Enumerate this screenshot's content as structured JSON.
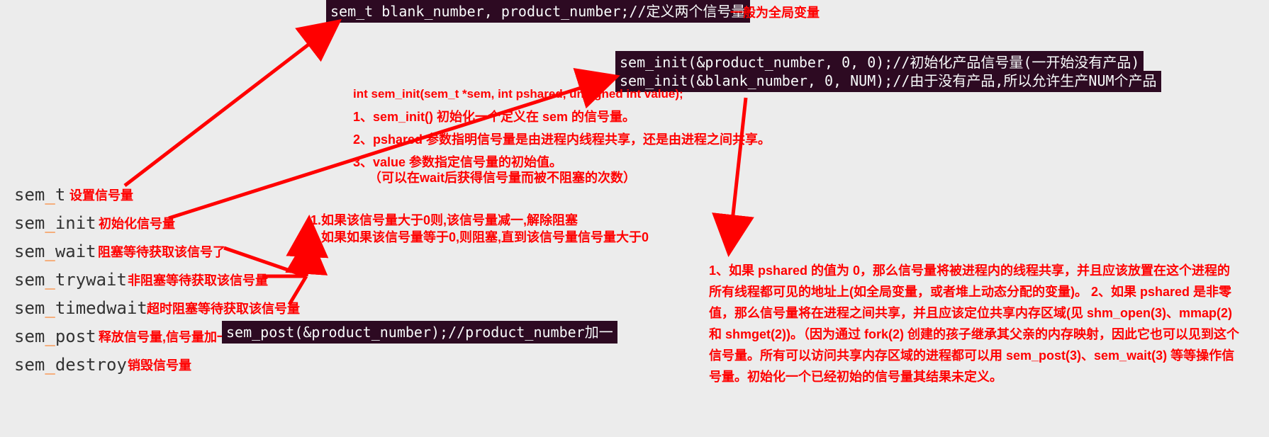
{
  "code_top": "sem_t blank_number, product_number;//定义两个信号量",
  "note_top_right": "一般为全局变量",
  "code_init1": "sem_init(&product_number, 0, 0);//初始化产品信号量(一开始没有产品)",
  "code_init2": "sem_init(&blank_number, 0, NUM);//由于没有产品,所以允许生产NUM个产品",
  "proto": "int sem_init(sem_t *sem, int pshared, unsigned int value);",
  "proto_note1": "1、sem_init() 初始化一个定义在 sem 的信号量。",
  "proto_note2": "2、pshared 参数指明信号量是由进程内线程共享，还是由进程之间共享。",
  "proto_note3a": "3、value 参数指定信号量的初始值。",
  "proto_note3b": "（可以在wait后获得信号量而被不阻塞的次数）",
  "wait_rule1": "1.如果该信号量大于0则,该信号量减一,解除阻塞",
  "wait_rule2": "2.如果如果该信号量等于0,则阻塞,直到该信号量信号量大于0",
  "api": {
    "sem_t": {
      "name": "sem_t",
      "desc": "设置信号量"
    },
    "sem_init": {
      "name": "sem_init",
      "desc": "初始化信号量"
    },
    "sem_wait": {
      "name": "sem_wait",
      "desc": "阻塞等待获取该信号了"
    },
    "sem_trywait": {
      "name": "sem_trywait",
      "desc": "非阻塞等待获取该信号量"
    },
    "sem_timedwait": {
      "name": "sem_timedwait",
      "desc": "超时阻塞等待获取该信号量"
    },
    "sem_post": {
      "name": "sem_post",
      "desc": "释放信号量,信号量加一"
    },
    "sem_destroy": {
      "name": "sem_destroy",
      "desc": "销毁信号量"
    }
  },
  "code_post": "sem_post(&product_number);//product_number加一",
  "pshared_para": "1、如果 pshared 的值为 0，那么信号量将被进程内的线程共享，并且应该放置在这个进程的所有线程都可见的地址上(如全局变量，或者堆上动态分配的变量)。\n2、如果 pshared 是非零值，那么信号量将在进程之间共享，并且应该定位共享内存区域(见 shm_open(3)、mmap(2) 和 shmget(2))。（因为通过 fork(2) 创建的孩子继承其父亲的内存映射，因此它也可以见到这个信号量。所有可以访问共享内存区域的进程都可以用 sem_post(3)、sem_wait(3) 等等操作信号量。初始化一个已经初始的信号量其结果未定义。"
}
